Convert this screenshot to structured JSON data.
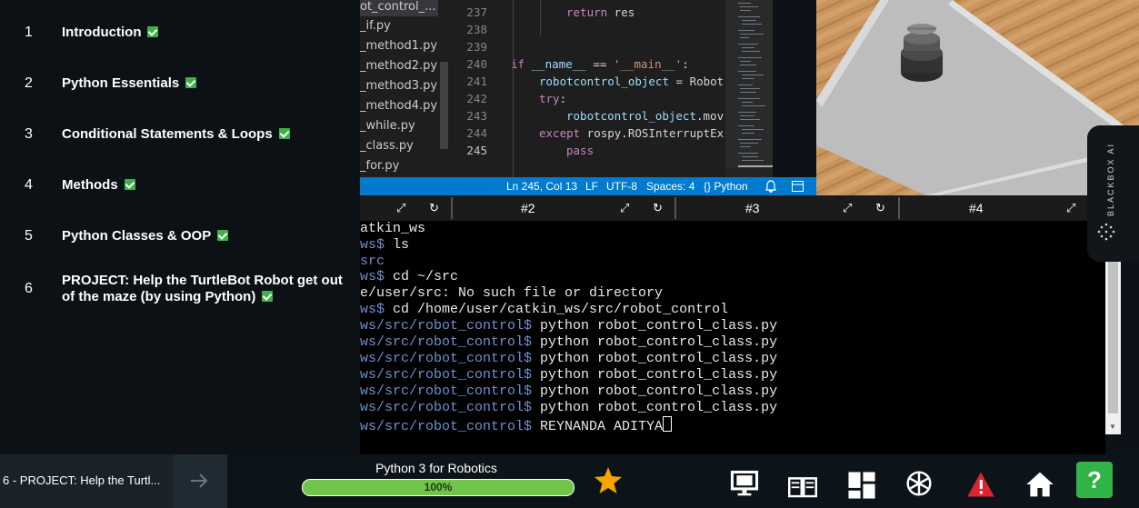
{
  "chapters": [
    {
      "num": "1",
      "label": "Introduction"
    },
    {
      "num": "2",
      "label": "Python Essentials"
    },
    {
      "num": "3",
      "label": "Conditional Statements & Loops"
    },
    {
      "num": "4",
      "label": "Methods"
    },
    {
      "num": "5",
      "label": "Python Classes & OOP"
    },
    {
      "num": "6",
      "label": "PROJECT: Help the TurtleBot Robot get out of the maze (by using Python)"
    }
  ],
  "files": [
    "ot_control_...",
    "_if.py",
    "_method1.py",
    "_method2.py",
    "_method3.py",
    "_method4.py",
    "_while.py",
    "_class.py",
    "_for.py"
  ],
  "editor": {
    "lines": [
      "237",
      "238",
      "239",
      "240",
      "241",
      "242",
      "243",
      "244",
      "245"
    ],
    "code": {
      "l237_kw": "return",
      "l237_rest": " res",
      "l240_kw": "if",
      "l240_name": "__name__",
      "l240_op": " == ",
      "l240_str": "'__main__'",
      "l240_colon": ":",
      "l241_var": "robotcontrol_object",
      "l241_rest": " = Robot",
      "l242_kw": "try",
      "l242_colon": ":",
      "l243_var": "robotcontrol_object",
      "l243_rest": ".mov",
      "l244_kw": "except",
      "l244_rest": " rospy.ROSInterruptEx",
      "l245_kw": "pass"
    }
  },
  "statusbar": {
    "position": "Ln 245, Col 13",
    "eol": "LF",
    "encoding": "UTF-8",
    "spaces": "Spaces: 4",
    "language": "Python"
  },
  "terminal_tabs": [
    "#2",
    "#3",
    "#4"
  ],
  "terminal": {
    "lines": [
      {
        "prompt": "",
        "text": "atkin_ws"
      },
      {
        "prompt": "ws$",
        "text": " ls"
      },
      {
        "prompt": "src",
        "text": ""
      },
      {
        "prompt": "ws$",
        "text": " cd ~/src"
      },
      {
        "prompt": "",
        "text": "e/user/src: No such file or directory"
      },
      {
        "prompt": "ws$",
        "text": " cd /home/user/catkin_ws/src/robot_control"
      },
      {
        "prompt": "ws/src/robot_control$",
        "text": " python robot_control_class.py"
      },
      {
        "prompt": "ws/src/robot_control$",
        "text": " python robot_control_class.py"
      },
      {
        "prompt": "ws/src/robot_control$",
        "text": " python robot_control_class.py"
      },
      {
        "prompt": "ws/src/robot_control$",
        "text": " python robot_control_class.py"
      },
      {
        "prompt": "ws/src/robot_control$",
        "text": " python robot_control_class.py"
      },
      {
        "prompt": "ws/src/robot_control$",
        "text": " python robot_control_class.py"
      },
      {
        "prompt": "ws/src/robot_control$",
        "text": " REYNANDA ADITYA"
      }
    ]
  },
  "blackbox": {
    "label": "BLACKBOX AI"
  },
  "bottombar": {
    "breadcrumb": "6 - PROJECT: Help the Turtl...",
    "course_title": "Python 3 for Robotics",
    "progress_text": "100%",
    "progress": 1.0
  },
  "help_label": "?",
  "colors": {
    "accent": "#007acc",
    "progress": "#70c44a",
    "check": "#3fb04a",
    "help": "#2fb445"
  }
}
